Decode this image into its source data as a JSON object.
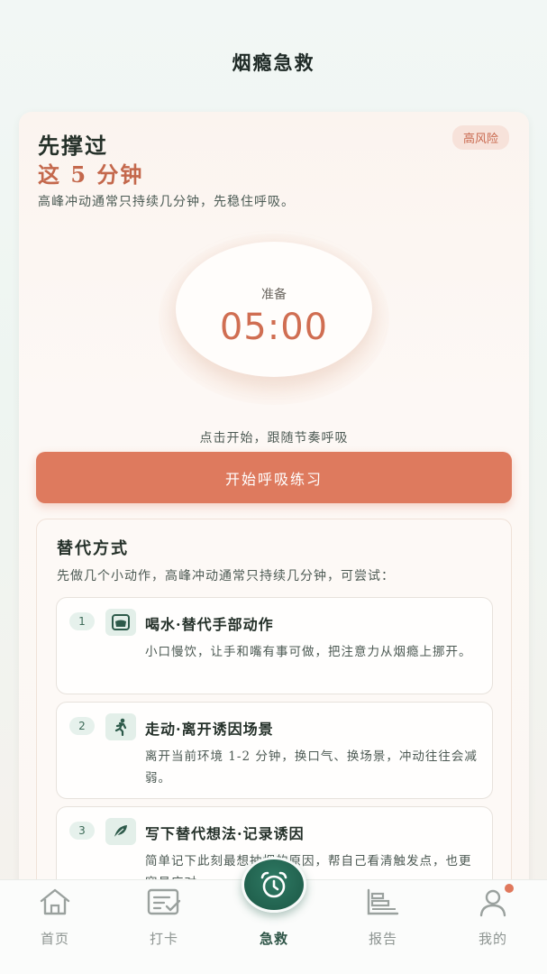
{
  "header": {
    "title": "烟瘾急救"
  },
  "hero": {
    "title_line1": "先撑过",
    "title_line2": "这 5 分钟",
    "risk_badge": "高风险",
    "subtitle": "高峰冲动通常只持续几分钟，先稳住呼吸。"
  },
  "timer": {
    "label": "准备",
    "value": "05:00",
    "hint": "点击开始，跟随节奏呼吸"
  },
  "start_button": {
    "label": "开始呼吸练习"
  },
  "alternatives": {
    "title": "替代方式",
    "subtitle": "先做几个小动作，高峰冲动通常只持续几分钟，可尝试：",
    "items": [
      {
        "num": "1",
        "icon": "cup-icon",
        "name": "喝水·替代手部动作",
        "desc": "小口慢饮，让手和嘴有事可做，把注意力从烟瘾上挪开。"
      },
      {
        "num": "2",
        "icon": "walking-icon",
        "name": "走动·离开诱因场景",
        "desc": "离开当前环境 1-2 分钟，换口气、换场景，冲动往往会减弱。"
      },
      {
        "num": "3",
        "icon": "leaf-pen-icon",
        "name": "写下替代想法·记录诱因",
        "desc": "简单记下此刻最想抽烟的原因，帮自己看清触发点，也更容易应对。"
      }
    ]
  },
  "tabbar": {
    "tabs": [
      {
        "label": "首页",
        "icon": "home-icon"
      },
      {
        "label": "打卡",
        "icon": "checkin-icon"
      },
      {
        "label": "急救",
        "icon": "alarm-clock-icon",
        "active": true
      },
      {
        "label": "报告",
        "icon": "report-icon"
      },
      {
        "label": "我的",
        "icon": "user-icon"
      }
    ]
  },
  "colors": {
    "accent": "#de7a5e",
    "brand_green": "#1f5e4b",
    "risk_text": "#c96a50"
  }
}
